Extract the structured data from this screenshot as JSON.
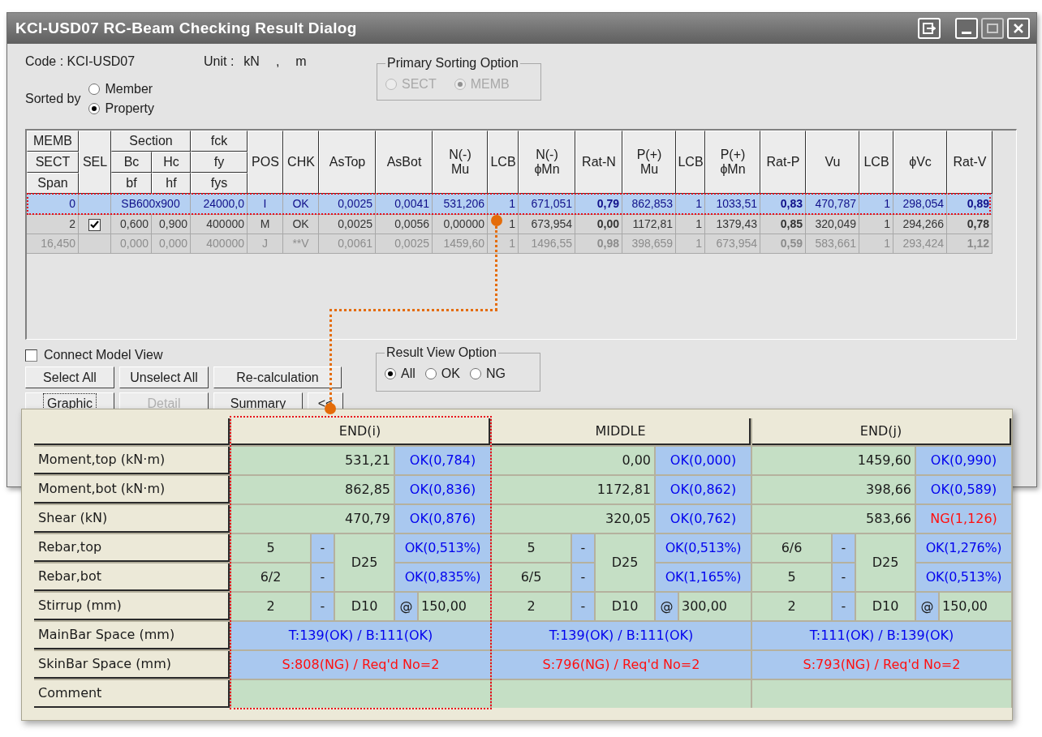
{
  "window": {
    "title": "KCI-USD07 RC-Beam Checking Result Dialog"
  },
  "code": "Code : KCI-USD07",
  "unit": {
    "label": "Unit :",
    "force": "kN",
    "separator": ",",
    "length": "m"
  },
  "sorted_by": {
    "label": "Sorted by",
    "disabled": false,
    "options": [
      {
        "label": "Member",
        "selected": false
      },
      {
        "label": "Property",
        "selected": true
      }
    ]
  },
  "primary_sorting": {
    "title": "Primary Sorting Option",
    "disabled": true,
    "options": [
      {
        "label": "SECT",
        "selected": false
      },
      {
        "label": "MEMB",
        "selected": true
      }
    ]
  },
  "table": {
    "header": [
      {
        "kind": "stack",
        "cells": [
          "MEMB",
          "SECT",
          "Span"
        ]
      },
      {
        "kind": "select",
        "lines": [
          "SEL"
        ]
      },
      {
        "kind": "section",
        "title": "Section",
        "cells": [
          [
            "Bc",
            "Hc"
          ],
          [
            "bf",
            "hf"
          ]
        ]
      },
      {
        "kind": "stack",
        "cells": [
          "fck",
          "fy",
          "fys"
        ]
      },
      {
        "kind": "single",
        "lines": [
          "POS"
        ],
        "bold": false
      },
      {
        "kind": "single",
        "lines": [
          "CHK"
        ],
        "bold": false
      },
      {
        "kind": "single",
        "lines": [
          "AsTop"
        ],
        "bold": false
      },
      {
        "kind": "single",
        "lines": [
          "AsBot"
        ],
        "bold": false
      },
      {
        "kind": "single",
        "lines": [
          "N(-)",
          "Mu"
        ],
        "bold": false
      },
      {
        "kind": "single",
        "lines": [
          "LCB"
        ],
        "bold": false
      },
      {
        "kind": "single",
        "lines": [
          "N(-)",
          "ϕMn"
        ],
        "bold": false
      },
      {
        "kind": "single",
        "lines": [
          "Rat-N"
        ],
        "bold": true
      },
      {
        "kind": "single",
        "lines": [
          "P(+)",
          "Mu"
        ],
        "bold": false
      },
      {
        "kind": "single",
        "lines": [
          "LCB"
        ],
        "bold": false
      },
      {
        "kind": "single",
        "lines": [
          "P(+)",
          "ϕMn"
        ],
        "bold": false
      },
      {
        "kind": "single",
        "lines": [
          "Rat-P"
        ],
        "bold": true
      },
      {
        "kind": "single",
        "lines": [
          "Vu"
        ],
        "bold": false
      },
      {
        "kind": "single",
        "lines": [
          "LCB"
        ],
        "bold": false
      },
      {
        "kind": "single",
        "lines": [
          "ϕVc"
        ],
        "bold": false
      },
      {
        "kind": "single",
        "lines": [
          "Rat-V"
        ],
        "bold": true
      }
    ],
    "rows": [
      {
        "selected": true,
        "highlighted": true,
        "dimmed": false,
        "cells": [
          "0",
          {
            "text": "SB600x900",
            "colspan": 2
          },
          "24000,0",
          "I",
          "OK",
          "0,0025",
          "0,0041",
          "531,206",
          "1",
          "671,051",
          "0,79",
          "862,853",
          "1",
          "1033,51",
          "0,83",
          "470,787",
          "1",
          "298,054",
          "0,89"
        ]
      },
      {
        "selected": false,
        "highlighted": false,
        "dimmed": false,
        "checked": true,
        "cells": [
          "2",
          "0,600",
          "0,900",
          "400000",
          "M",
          "OK",
          "0,0025",
          "0,0056",
          "0,00000",
          "1",
          "673,954",
          "0,00",
          "1172,81",
          "1",
          "1379,43",
          "0,85",
          "320,049",
          "1",
          "294,266",
          "0,78"
        ]
      },
      {
        "selected": false,
        "highlighted": false,
        "dimmed": true,
        "cells": [
          "16,450",
          "0,000",
          "0,000",
          "400000",
          "J",
          "**V",
          "0,0061",
          "0,0025",
          "1459,60",
          "1",
          "1496,55",
          "0,98",
          "398,659",
          "1",
          "673,954",
          "0,59",
          "583,661",
          "1",
          "293,424",
          "1,12"
        ]
      }
    ]
  },
  "connect_model_view": {
    "label": "Connect Model View",
    "checked": false
  },
  "buttons": [
    {
      "label": "Select All",
      "disabled": false,
      "focused": false
    },
    {
      "label": "Unselect All",
      "disabled": false,
      "focused": false
    },
    {
      "label": "Re-calculation",
      "disabled": false,
      "focused": false
    },
    {
      "label": "Graphic",
      "disabled": false,
      "focused": true
    },
    {
      "label": "Detail",
      "disabled": true,
      "focused": false
    },
    {
      "label": "Summary",
      "disabled": false,
      "focused": false
    },
    {
      "label": "<<",
      "disabled": false,
      "focused": false
    }
  ],
  "result_view": {
    "title": "Result View Option",
    "disabled": false,
    "options": [
      {
        "label": "All",
        "selected": true
      },
      {
        "label": "OK",
        "selected": false
      },
      {
        "label": "NG",
        "selected": false
      }
    ]
  },
  "detail": {
    "row_labels": [
      "Moment,top (kN·m)",
      "Moment,bot (kN·m)",
      "Shear (kN)",
      "Rebar,top",
      "Rebar,bot",
      "Stirrup (mm)",
      "MainBar Space (mm)",
      "SkinBar Space (mm)",
      "Comment"
    ],
    "sections": [
      {
        "title": "END(i)",
        "highlighted": true,
        "moment_top": {
          "value": "531,21",
          "status": "OK(0,784)",
          "pass": true
        },
        "moment_bot": {
          "value": "862,85",
          "status": "OK(0,836)",
          "pass": true
        },
        "shear": {
          "value": "470,79",
          "status": "OK(0,876)",
          "pass": true
        },
        "rebar": {
          "bar": "D25",
          "top": {
            "count": "5",
            "dash": "-",
            "status": "OK(0,513%)",
            "pass": true
          },
          "bot": {
            "count": "6/2",
            "dash": "-",
            "status": "OK(0,835%)",
            "pass": true
          }
        },
        "stirrup": {
          "count": "2",
          "dash": "-",
          "bar": "D10",
          "at": "@",
          "spacing": "150,00"
        },
        "mainbar": {
          "text": "T:139(OK) / B:111(OK)",
          "pass": true
        },
        "skinbar": {
          "text": "S:808(NG) / Req'd No=2",
          "pass": false
        }
      },
      {
        "title": "MIDDLE",
        "highlighted": false,
        "moment_top": {
          "value": "0,00",
          "status": "OK(0,000)",
          "pass": true
        },
        "moment_bot": {
          "value": "1172,81",
          "status": "OK(0,862)",
          "pass": true
        },
        "shear": {
          "value": "320,05",
          "status": "OK(0,762)",
          "pass": true
        },
        "rebar": {
          "bar": "D25",
          "top": {
            "count": "5",
            "dash": "-",
            "status": "OK(0,513%)",
            "pass": true
          },
          "bot": {
            "count": "6/5",
            "dash": "-",
            "status": "OK(1,165%)",
            "pass": true
          }
        },
        "stirrup": {
          "count": "2",
          "dash": "-",
          "bar": "D10",
          "at": "@",
          "spacing": "300,00"
        },
        "mainbar": {
          "text": "T:139(OK) / B:111(OK)",
          "pass": true
        },
        "skinbar": {
          "text": "S:796(NG) / Req'd No=2",
          "pass": false
        }
      },
      {
        "title": "END(j)",
        "highlighted": false,
        "moment_top": {
          "value": "1459,60",
          "status": "OK(0,990)",
          "pass": true
        },
        "moment_bot": {
          "value": "398,66",
          "status": "OK(0,589)",
          "pass": true
        },
        "shear": {
          "value": "583,66",
          "status": "NG(1,126)",
          "pass": false
        },
        "rebar": {
          "bar": "D25",
          "top": {
            "count": "6/6",
            "dash": "-",
            "status": "OK(1,276%)",
            "pass": true
          },
          "bot": {
            "count": "5",
            "dash": "-",
            "status": "OK(0,513%)",
            "pass": true
          }
        },
        "stirrup": {
          "count": "2",
          "dash": "-",
          "bar": "D10",
          "at": "@",
          "spacing": "150,00"
        },
        "mainbar": {
          "text": "T:111(OK) / B:139(OK)",
          "pass": true
        },
        "skinbar": {
          "text": "S:793(NG) / Req'd No=2",
          "pass": false
        }
      }
    ]
  }
}
